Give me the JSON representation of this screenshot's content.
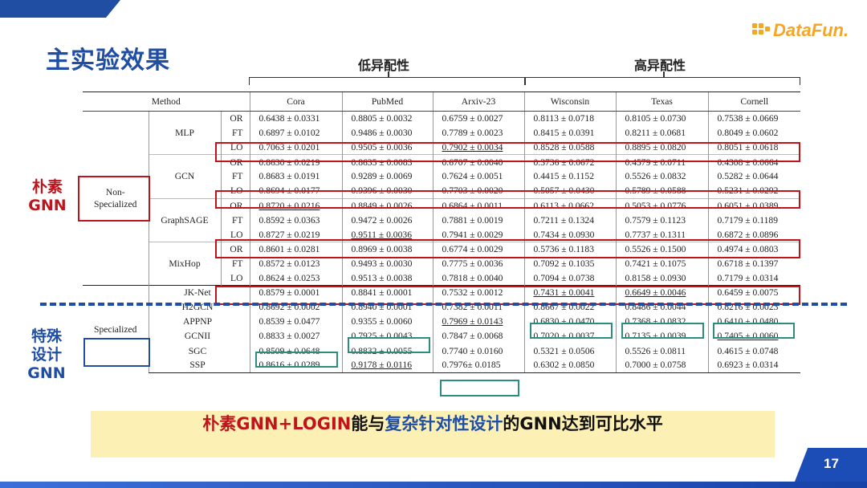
{
  "title": "主实验效果",
  "logo": {
    "text": "DataFun."
  },
  "page_number": "17",
  "groups": {
    "low": "低异配性",
    "high": "高异配性"
  },
  "table": {
    "headers": [
      "Method",
      "Cora",
      "PubMed",
      "Arxiv-23",
      "Wisconsin",
      "Texas",
      "Cornell"
    ],
    "category_non": "Non-\nSpecialized",
    "category_spec": "Specialized",
    "models": {
      "mlp": {
        "name": "MLP",
        "rows": [
          [
            "OR",
            "0.6438 ± 0.0331",
            "0.8805 ± 0.0032",
            "0.6759 ± 0.0027",
            "0.8113 ± 0.0718",
            "0.8105 ± 0.0730",
            "0.7538 ± 0.0669"
          ],
          [
            "FT",
            "0.6897 ± 0.0102",
            "0.9486 ± 0.0030",
            "0.7789 ± 0.0023",
            "0.8415 ± 0.0391",
            "0.8211 ± 0.0681",
            "0.8049 ± 0.0602"
          ],
          [
            "LO",
            "0.7063 ± 0.0201",
            "0.9505 ± 0.0036",
            "0.7902 ± 0.0034",
            "0.8528 ± 0.0588",
            "0.8895 ± 0.0820",
            "0.8051 ± 0.0618"
          ]
        ]
      },
      "gcn": {
        "name": "GCN",
        "rows": [
          [
            "OR",
            "0.8630 ± 0.0219",
            "0.8635 ± 0.0083",
            "0.6707 ± 0.0040",
            "0.3736 ± 0.0672",
            "0.4579 ± 0.0711",
            "0.4308 ± 0.0664"
          ],
          [
            "FT",
            "0.8683 ± 0.0191",
            "0.9289 ± 0.0069",
            "0.7624 ± 0.0051",
            "0.4415 ± 0.1152",
            "0.5526 ± 0.0832",
            "0.5282 ± 0.0644"
          ],
          [
            "LO",
            "0.8694 ± 0.0177",
            "0.9396 ± 0.0030",
            "0.7703 ± 0.0020",
            "0.5057 ± 0.0430",
            "0.5789 ± 0.0588",
            "0.5231 ± 0.0292"
          ]
        ]
      },
      "sage": {
        "name": "GraphSAGE",
        "rows": [
          [
            "OR",
            "0.8720 ± 0.0216",
            "0.8849 ± 0.0026",
            "0.6864 ± 0.0011",
            "0.6113 ± 0.0662",
            "0.5053 ± 0.0776",
            "0.6051 ± 0.0389"
          ],
          [
            "FT",
            "0.8592 ± 0.0363",
            "0.9472 ± 0.0026",
            "0.7881 ± 0.0019",
            "0.7211 ± 0.1324",
            "0.7579 ± 0.1123",
            "0.7179 ± 0.1189"
          ],
          [
            "LO",
            "0.8727 ± 0.0219",
            "0.9511 ± 0.0036",
            "0.7941 ± 0.0029",
            "0.7434 ± 0.0930",
            "0.7737 ± 0.1311",
            "0.6872 ± 0.0896"
          ]
        ]
      },
      "mixhop": {
        "name": "MixHop",
        "rows": [
          [
            "OR",
            "0.8601 ± 0.0281",
            "0.8969 ± 0.0038",
            "0.6774 ± 0.0029",
            "0.5736 ± 0.1183",
            "0.5526 ± 0.1500",
            "0.4974 ± 0.0803"
          ],
          [
            "FT",
            "0.8572 ± 0.0123",
            "0.9493 ± 0.0030",
            "0.7775 ± 0.0036",
            "0.7092 ± 0.1035",
            "0.7421 ± 0.1075",
            "0.6718 ± 0.1397"
          ],
          [
            "LO",
            "0.8624 ± 0.0253",
            "0.9513 ± 0.0038",
            "0.7818 ± 0.0040",
            "0.7094 ± 0.0738",
            "0.8158 ± 0.0930",
            "0.7179 ± 0.0314"
          ]
        ]
      }
    },
    "specialized": [
      [
        "JK-Net",
        "0.8579 ± 0.0001",
        "0.8841 ± 0.0001",
        "0.7532 ± 0.0012",
        "0.7431 ± 0.0041",
        "0.6649 ± 0.0046",
        "0.6459 ± 0.0075"
      ],
      [
        "H2GCN",
        "0.8692 ± 0.0002",
        "0.8940 ± 0.0001",
        "0.7382 ± 0.0011",
        "0.8667 ± 0.0022",
        "0.8486 ± 0.0044",
        "0.8216 ± 0.0023"
      ],
      [
        "APPNP",
        "0.8539 ± 0.0477",
        "0.9355 ± 0.0060",
        "0.7969 ± 0.0143",
        "0.6830 ± 0.0470",
        "0.7368 ± 0.0832",
        "0.6410 ± 0.0480"
      ],
      [
        "GCNII",
        "0.8833 ± 0.0027",
        "0.7925 ± 0.0043",
        "0.7847 ± 0.0068",
        "0.7020 ± 0.0037",
        "0.7135 ± 0.0039",
        "0.7405 ± 0.0060"
      ],
      [
        "SGC",
        "0.8509 ± 0.0648",
        "0.8832 ± 0.0055",
        "0.7740 ± 0.0160",
        "0.5321 ± 0.0506",
        "0.5526 ± 0.0811",
        "0.4615 ± 0.0748"
      ],
      [
        "SSP",
        "0.8616 ± 0.0289",
        "0.9178 ± 0.0116",
        "0.7976± 0.0185",
        "0.6302 ± 0.0850",
        "0.7000 ± 0.0758",
        "0.6923 ± 0.0314"
      ]
    ]
  },
  "side_labels": {
    "naive": "朴素\nGNN",
    "special": "特殊\n设计\nGNN"
  },
  "banner": {
    "red": "朴素GNN+LOGIN",
    "black1": "能与",
    "blue": "复杂针对性设计",
    "black2": "的GNN达到可比水平"
  },
  "colors": {
    "brand_blue": "#1f4ea3",
    "red": "#c0141c",
    "teal": "#2e8b80",
    "banner_bg": "#fdf0b4",
    "logo_orange": "#f5a623"
  }
}
